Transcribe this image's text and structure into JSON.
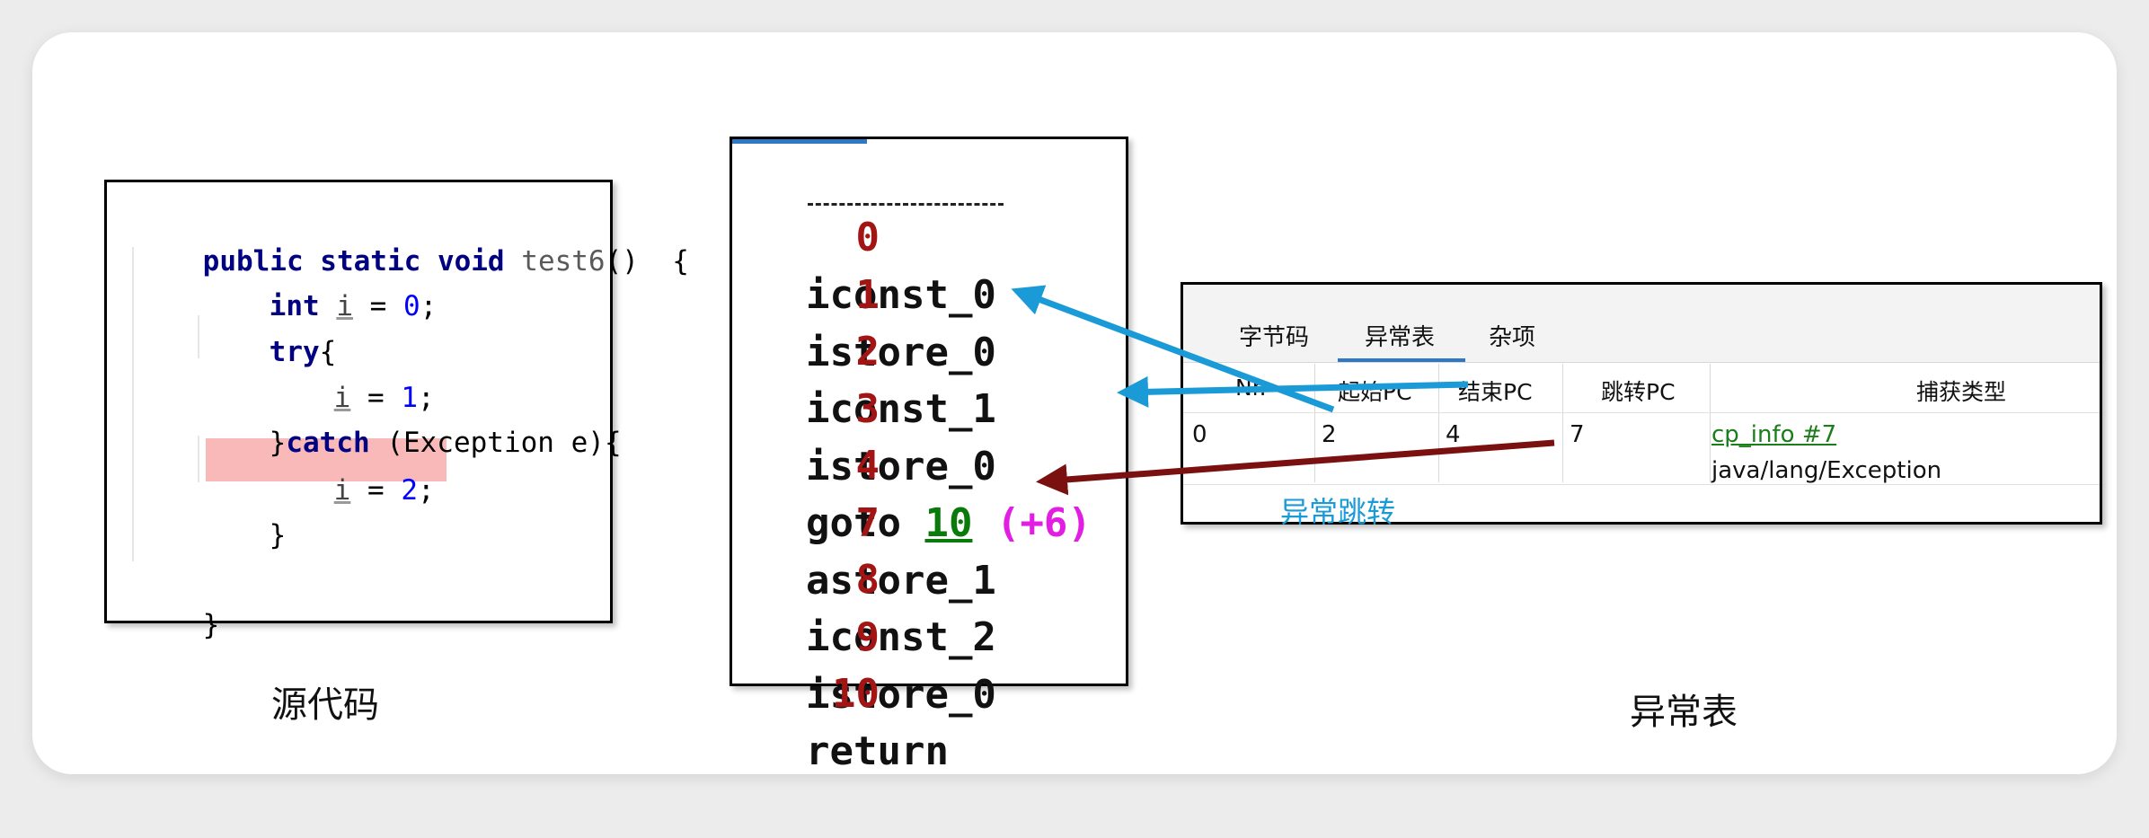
{
  "source_code": {
    "lines": [
      [
        "public static void",
        "test6",
        "()  {"
      ],
      [
        "int",
        "i",
        " = ",
        "0",
        ";"
      ],
      [
        "try",
        "{"
      ],
      [
        "i",
        " = ",
        "1",
        ";"
      ],
      [
        "}",
        "catch",
        " (Exception e){"
      ],
      [
        "i",
        " = ",
        "2",
        ";"
      ],
      [
        "}"
      ],
      [
        "}"
      ]
    ],
    "caption": "源代码"
  },
  "bytecode": {
    "rows": [
      {
        "offset": "0",
        "op": "iconst_0"
      },
      {
        "offset": "1",
        "op": "istore_0"
      },
      {
        "offset": "2",
        "op": "iconst_1"
      },
      {
        "offset": "3",
        "op": "istore_0"
      },
      {
        "offset": "4",
        "op": "goto",
        "target": "10",
        "delta": "(+6)"
      },
      {
        "offset": "7",
        "op": "astore_1"
      },
      {
        "offset": "8",
        "op": "iconst_2"
      },
      {
        "offset": "9",
        "op": "istore_0"
      },
      {
        "offset": "10",
        "op": "return"
      }
    ]
  },
  "exception_table": {
    "tabs": [
      "字节码",
      "异常表",
      "杂项"
    ],
    "active_tab": "异常表",
    "columns": [
      "Nr.",
      "起始PC",
      "结束PC",
      "跳转PC",
      "捕获类型"
    ],
    "row": {
      "nr": "0",
      "start_pc": "2",
      "end_pc": "4",
      "handler_pc": "7",
      "catch_ref": "cp_info #7",
      "catch_type": "java/lang/Exception"
    },
    "jump_label": "异常跳转",
    "caption": "异常表"
  },
  "colors": {
    "arrow_blue": "#1a9ad6",
    "arrow_dark_red": "#7a1010",
    "highlight": "#f9b9b9",
    "offset_red": "#a31515",
    "goto_target_green": "#0a7a0a",
    "delta_magenta": "#e21ee2",
    "keyword_navy": "#000080"
  }
}
